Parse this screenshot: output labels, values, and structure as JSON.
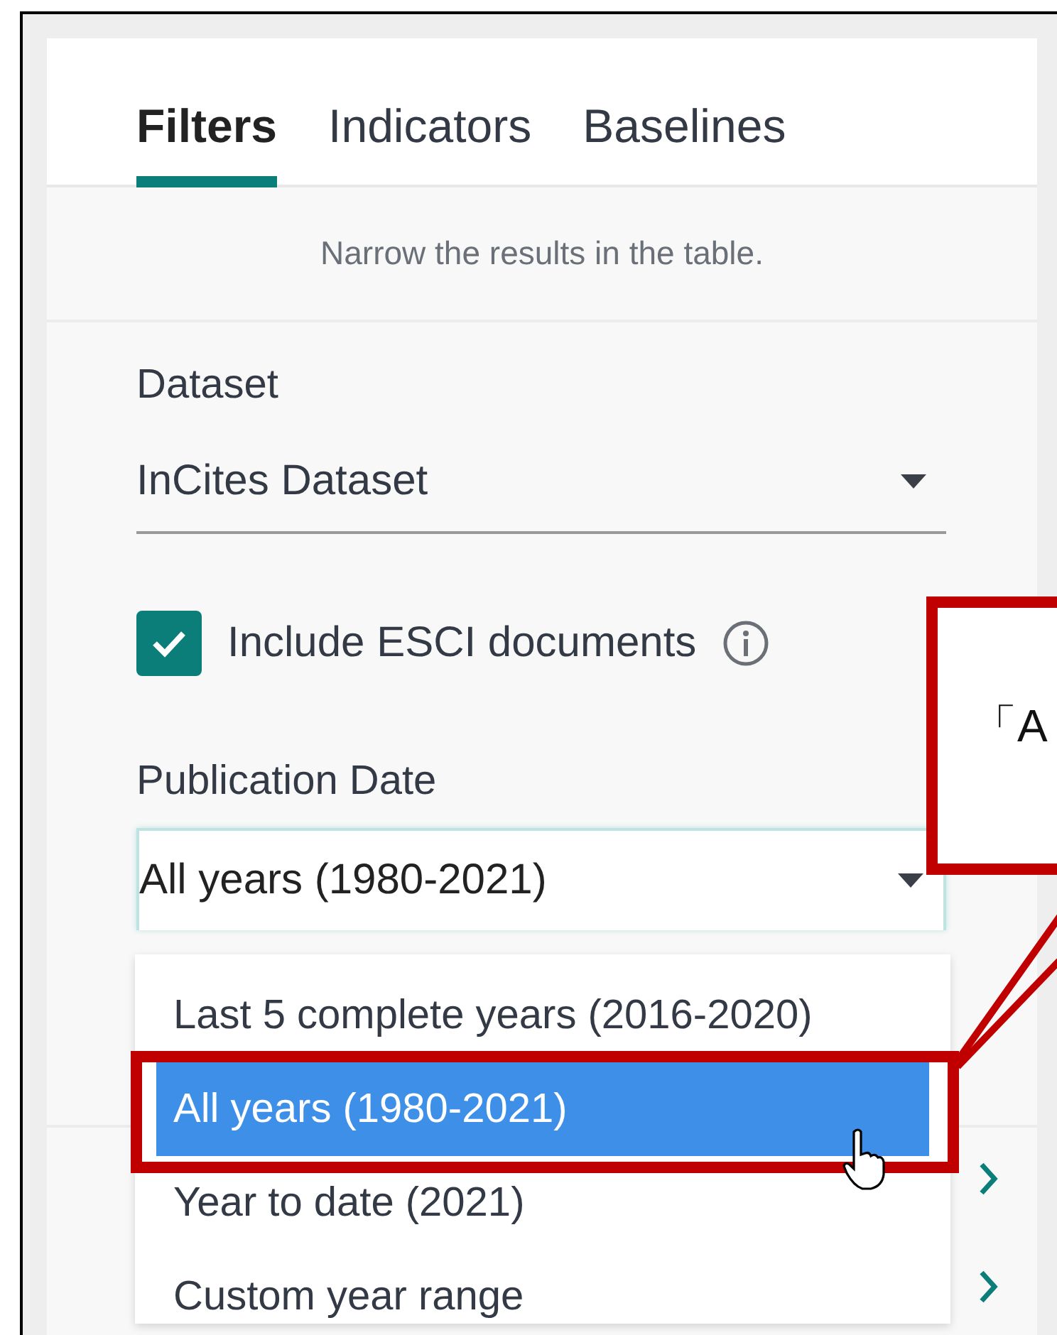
{
  "tabs": [
    {
      "label": "Filters",
      "selected": true
    },
    {
      "label": "Indicators",
      "selected": false
    },
    {
      "label": "Baselines",
      "selected": false
    }
  ],
  "subtitle": "Narrow the results in the table.",
  "dataset": {
    "label": "Dataset",
    "value": "InCites Dataset"
  },
  "esci": {
    "label": "Include ESCI documents",
    "checked": true
  },
  "publication_date": {
    "label": "Publication Date",
    "value": "All years (1980-2021)",
    "options": [
      {
        "label": "Last 5 complete years (2016-2020)",
        "selected": false
      },
      {
        "label": "All years (1980-2021)",
        "selected": true
      },
      {
        "label": "Year to date (2021)",
        "selected": false
      },
      {
        "label": "Custom year range",
        "selected": false
      }
    ]
  },
  "callout": {
    "text": "「A"
  }
}
